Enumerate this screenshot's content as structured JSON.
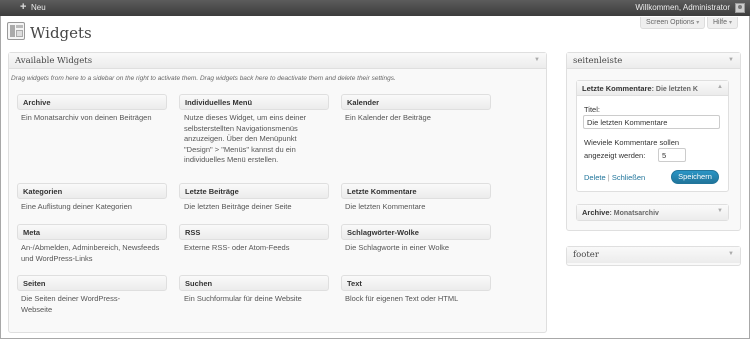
{
  "adminbar": {
    "new_label": "Neu",
    "welcome": "Willkommen, Administrator"
  },
  "toptabs": {
    "screen_options": "Screen Options",
    "help": "Hilfe"
  },
  "page": {
    "title": "Widgets"
  },
  "available": {
    "title": "Available Widgets",
    "description": "Drag widgets from here to a sidebar on the right to activate them. Drag widgets back here to deactivate them and delete their settings.",
    "widgets": [
      {
        "title": "Archive",
        "desc": "Ein Monatsarchiv von deinen Beiträgen"
      },
      {
        "title": "Individuelles Menü",
        "desc": "Nutze dieses Widget, um eins deiner selbsterstellten Navigationsmenüs anzuzeigen. Über den Menüpunkt \"Design\" > \"Menüs\" kannst du ein individuelles Menü erstellen."
      },
      {
        "title": "Kalender",
        "desc": "Ein Kalender der Beiträge"
      },
      {
        "title": "Kategorien",
        "desc": "Eine Auflistung deiner Kategorien"
      },
      {
        "title": "Letzte Beiträge",
        "desc": "Die letzten Beiträge deiner Seite"
      },
      {
        "title": "Letzte Kommentare",
        "desc": "Die letzten Kommentare"
      },
      {
        "title": "Meta",
        "desc": "An-/Abmelden, Adminbereich, Newsfeeds und WordPress-Links"
      },
      {
        "title": "RSS",
        "desc": "Externe RSS- oder Atom-Feeds"
      },
      {
        "title": "Schlagwörter-Wolke",
        "desc": "Die Schlagworte in einer Wolke"
      },
      {
        "title": "Seiten",
        "desc": "Die Seiten deiner WordPress-Webseite"
      },
      {
        "title": "Suchen",
        "desc": "Ein Suchformular für deine Website"
      },
      {
        "title": "Text",
        "desc": "Block für eigenen Text oder HTML"
      }
    ]
  },
  "sidebar": {
    "title": "seitenleiste",
    "open_widget": {
      "name": "Letzte Kommentare",
      "subtitle": ": Die letzten K",
      "title_label": "Titel:",
      "title_value": "Die letzten Kommentare",
      "count_label_line1": "Wieviele Kommentare sollen",
      "count_label_line2": "angezeigt werden:",
      "count_value": "5",
      "delete_label": "Delete",
      "separator": "|",
      "close_label": "Schließen",
      "save_label": "Speichern"
    },
    "closed_widget": {
      "name": "Archive",
      "subtitle": ": Monatsarchiv"
    }
  },
  "footer_area": {
    "title": "footer"
  },
  "colors": {
    "adminbar": "#464646",
    "link": "#21759b",
    "primary_button": "#21759b"
  }
}
